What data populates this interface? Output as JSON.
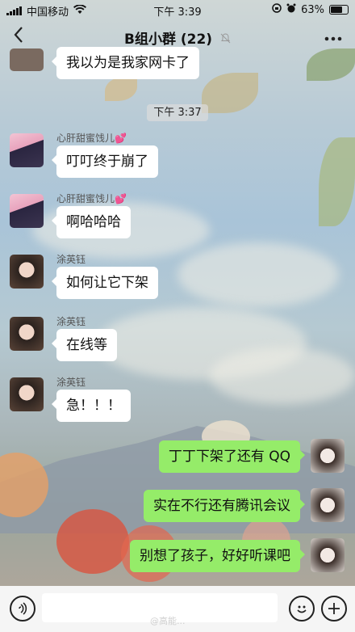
{
  "status_bar": {
    "carrier": "中国移动",
    "time": "下午 3:39",
    "battery": "63%",
    "battery_level": 0.63
  },
  "nav": {
    "back_icon": "chevron-left-icon",
    "title": "B组小群 (22)",
    "mute_icon": "bell-slash-icon",
    "more_icon": "ellipsis-icon"
  },
  "messages": [
    {
      "text": "我以为是我家网卡了"
    },
    {
      "timestamp": "下午 3:37"
    },
    {
      "sender": "心肝甜蜜饯儿💕",
      "text": "叮叮终于崩了"
    },
    {
      "sender": "心肝甜蜜饯儿💕",
      "text": "啊哈哈哈"
    },
    {
      "sender": "涂英钰",
      "text": "如何让它下架"
    },
    {
      "sender": "涂英钰",
      "text": "在线等"
    },
    {
      "sender": "涂英钰",
      "text": "急！！！"
    },
    {
      "text": "丁丁下架了还有 QQ"
    },
    {
      "text": "实在不行还有腾讯会议"
    },
    {
      "text": "别想了孩子，好好听课吧"
    }
  ],
  "input_bar": {
    "voice_icon": "voice-icon",
    "emoji_icon": "emoji-icon",
    "add_icon": "plus-icon"
  },
  "watermark": "@高能..."
}
